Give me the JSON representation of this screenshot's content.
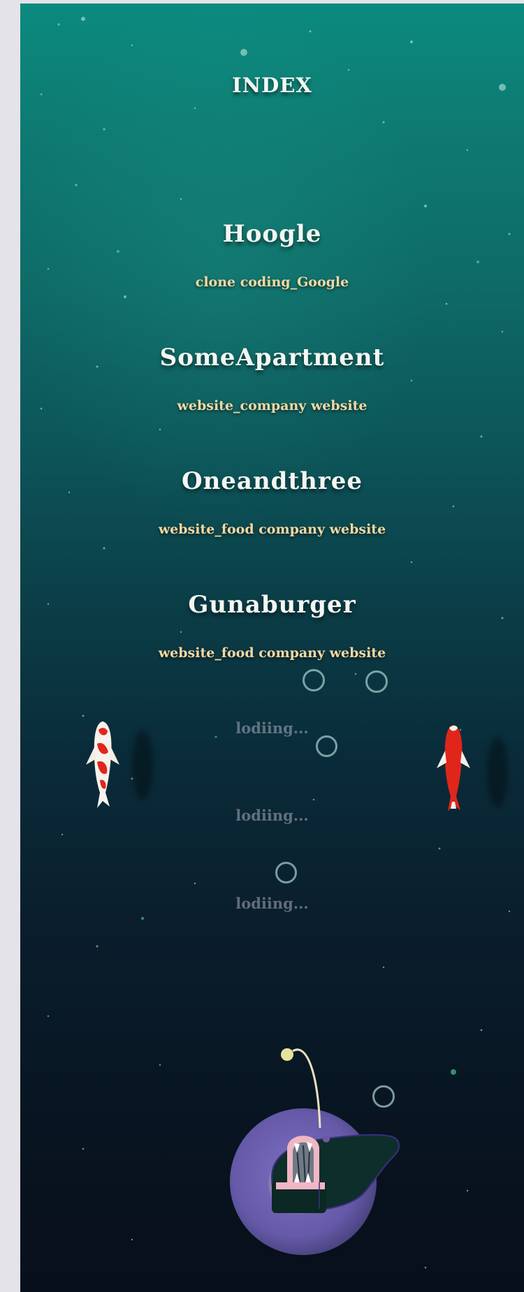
{
  "page": {
    "title": "INDEX"
  },
  "projects": [
    {
      "name": "Hoogle",
      "desc": "clone coding_Google"
    },
    {
      "name": "SomeApartment",
      "desc": "website_company website"
    },
    {
      "name": "Oneandthree",
      "desc": "website_food company website"
    },
    {
      "name": "Gunaburger",
      "desc": "website_food company website"
    }
  ],
  "loading": [
    {
      "text": "lodiing..."
    },
    {
      "text": "lodiing..."
    },
    {
      "text": "lodiing..."
    }
  ],
  "colors": {
    "sea_top": "#0b8a7f",
    "sea_bottom": "#070f1a",
    "title": "#f4f6f3",
    "description": "#f2d8a3",
    "koi_red": "#e0261a",
    "angler_glow": "#6559a8"
  }
}
